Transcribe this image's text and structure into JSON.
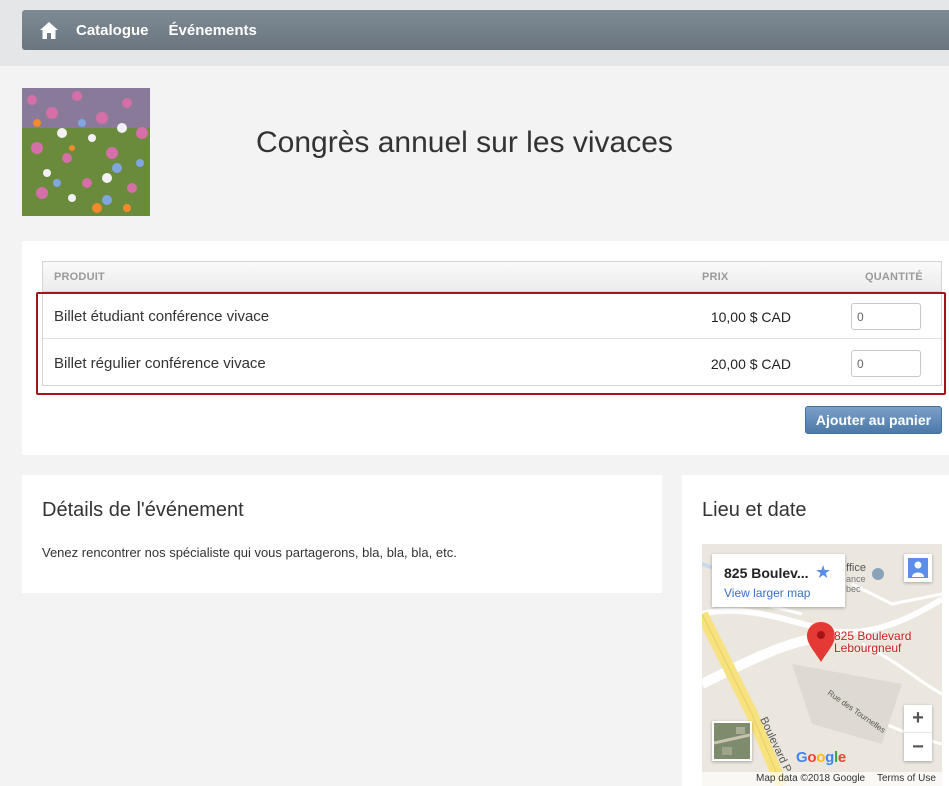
{
  "nav": {
    "home_icon": "home-icon",
    "items": [
      {
        "label": "Catalogue"
      },
      {
        "label": "Événements"
      }
    ]
  },
  "event": {
    "title": "Congrès annuel sur les vivaces"
  },
  "products": {
    "headers": {
      "product": "PRODUIT",
      "price": "PRIX",
      "quantity": "QUANTITÉ"
    },
    "rows": [
      {
        "name": "Billet étudiant conférence vivace",
        "price": "10,00 $ CAD",
        "qty": "0"
      },
      {
        "name": "Billet régulier conférence vivace",
        "price": "20,00 $ CAD",
        "qty": "0"
      }
    ],
    "add_to_cart": "Ajouter au panier"
  },
  "details": {
    "heading": "Détails de l'événement",
    "text": "Venez rencontrer nos spécialiste qui vous partagerons, bla, bla, bla, etc."
  },
  "location": {
    "heading": "Lieu et date",
    "map": {
      "info_address": "825 Boulev...",
      "view_larger": "View larger map",
      "pin_label_line1": "825 Boulevard",
      "pin_label_line2": "Lebourgneuf",
      "street_1": "Rue des Tournelles",
      "street_2": "Boulevard P",
      "poi_1": "ffice",
      "poi_2": "ance",
      "poi_3": "bec",
      "zoom_in": "+",
      "zoom_out": "−",
      "google": "Google",
      "map_data": "Map data ©2018 Google",
      "terms": "Terms of Use"
    }
  },
  "colors": {
    "navbar": "#737f89",
    "highlight": "#a0161c",
    "button": "#5a86b4",
    "pin": "#e53935"
  }
}
